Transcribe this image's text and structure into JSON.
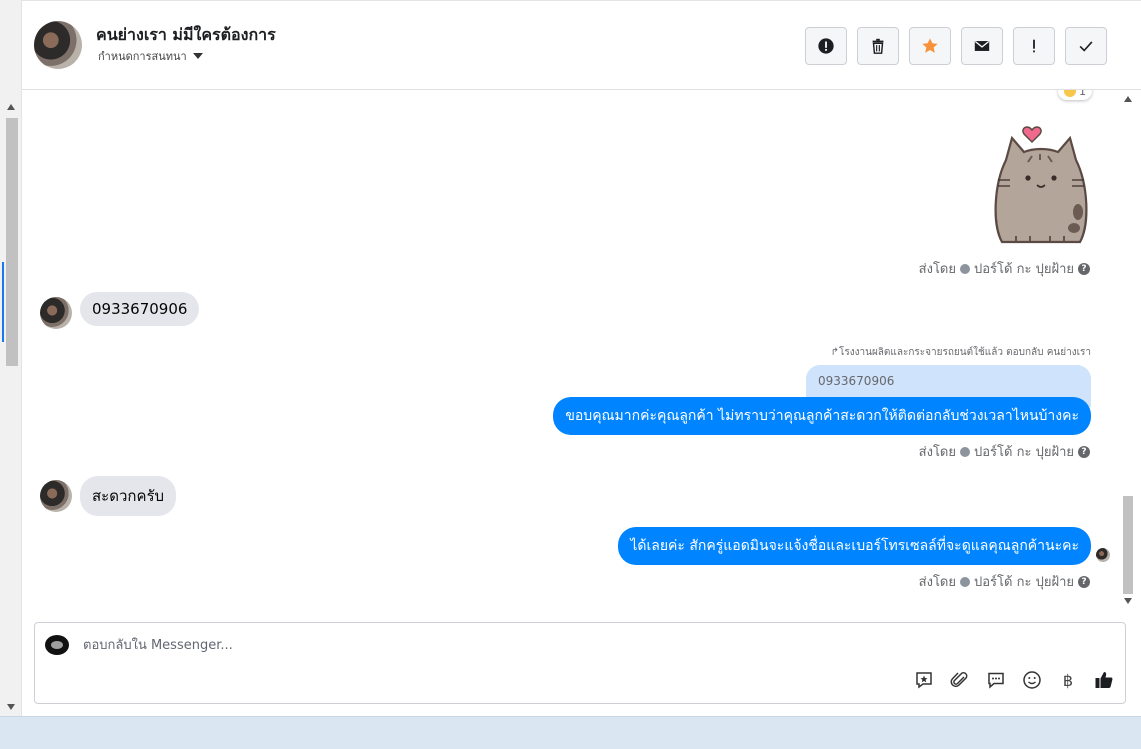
{
  "header": {
    "contact_name": "คนย่างเรา ม่มีใครต้องการ",
    "assign_label": "กำหนดการสนทนา"
  },
  "actions": [
    {
      "name": "report-spam-button",
      "icon": "alert-circle-icon"
    },
    {
      "name": "delete-button",
      "icon": "trash-icon"
    },
    {
      "name": "star-button",
      "icon": "star-icon",
      "color": "#f7923a"
    },
    {
      "name": "mark-unread-button",
      "icon": "envelope-icon"
    },
    {
      "name": "follow-up-button",
      "icon": "exclamation-icon"
    },
    {
      "name": "done-button",
      "icon": "check-icon"
    }
  ],
  "messages": {
    "reaction_count": "1",
    "sent_by_label": "ส่งโดย",
    "sent_by_name": "ปอร์โด้ กะ ปุยฝ้าย",
    "incoming_1": "0933670906",
    "reply_note": "↱โรงงานผลิตและกระจายรถยนต์ใช้แล้ว ตอบกลับ คนย่างเรา",
    "quoted_text": "0933670906",
    "outgoing_1": "ขอบคุณมากค่ะคุณลูกค้า ไม่ทราบว่าคุณลูกค้าสะดวกให้ติดต่อกลับช่วงเวลาไหนบ้างคะ",
    "incoming_2": "สะดวกครับ",
    "outgoing_2": "ได้เลยค่ะ สักครู่แอดมินจะแจ้งชื่อและเบอร์โทรเซลล์ที่จะดูแลคุณลูกค้านะคะ"
  },
  "composer": {
    "placeholder": "ตอบกลับใน Messenger...",
    "tools": [
      "saved-reply-icon",
      "attachment-icon",
      "chat-bubble-icon",
      "emoji-icon",
      "baht-icon",
      "thumbs-up-icon"
    ],
    "baht_symbol": "฿"
  },
  "colors": {
    "outgoing_bubble": "#0084ff",
    "incoming_bubble": "#e4e6eb",
    "quoted_bg": "#cfe3fc",
    "star": "#f7923a"
  }
}
